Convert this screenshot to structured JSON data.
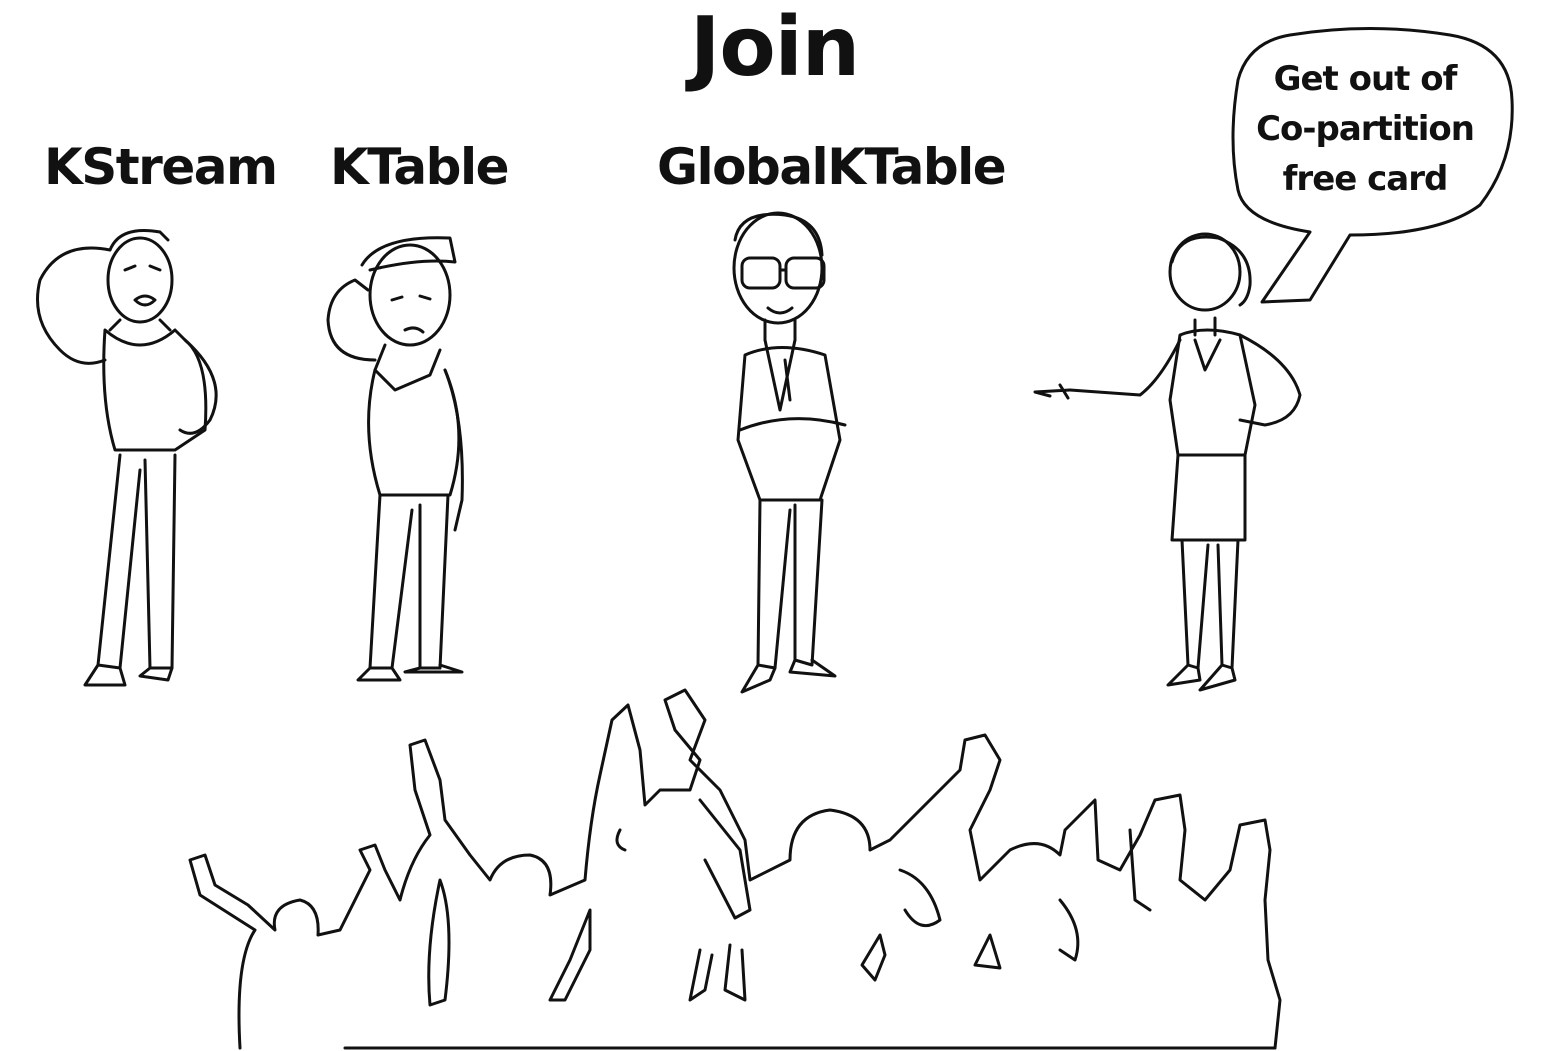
{
  "title": "Join",
  "characters": [
    {
      "label": "KStream"
    },
    {
      "label": "KTable"
    },
    {
      "label": "GlobalKTable"
    }
  ],
  "speech_bubble": {
    "lines": [
      "Get out of",
      "Co-partition",
      "free card"
    ]
  }
}
